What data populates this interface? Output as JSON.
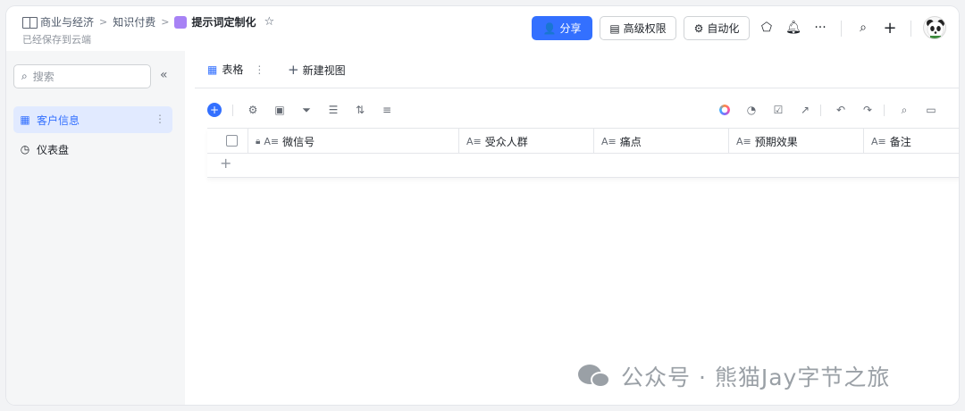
{
  "header": {
    "breadcrumbs": [
      "商业与经济",
      "知识付费",
      "提示词定制化"
    ],
    "saved_status": "已经保存到云端",
    "share_label": "分享",
    "permissions_label": "高级权限",
    "automation_label": "自动化",
    "more_label": "···"
  },
  "sidebar": {
    "search_placeholder": "搜索",
    "items": [
      {
        "label": "客户信息",
        "icon": "table-icon",
        "active": true
      },
      {
        "label": "仪表盘",
        "icon": "dashboard-icon",
        "active": false
      }
    ]
  },
  "main": {
    "tabs": [
      {
        "label": "表格",
        "icon": "grid-icon"
      },
      {
        "label": "新建视图",
        "icon": "plus-icon"
      }
    ],
    "columns": [
      "微信号",
      "受众人群",
      "痛点",
      "预期效果",
      "备注"
    ],
    "add_row_label": "+"
  },
  "watermark": {
    "text": "公众号 · 熊猫Jay字节之旅"
  },
  "colors": {
    "accent": "#3370ff",
    "doc_icon": "#a782f5",
    "active_bg": "#e1eaff"
  }
}
